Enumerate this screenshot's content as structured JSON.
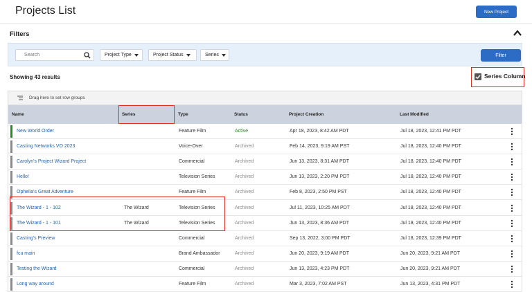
{
  "header": {
    "title": "Projects List",
    "new_project_label": "New Project"
  },
  "filters": {
    "title": "Filters",
    "search_placeholder": "Search",
    "project_type_label": "Project Type",
    "project_status_label": "Project Status",
    "series_label": "Series",
    "filter_button_label": "Filter"
  },
  "results": {
    "count_text": "Showing 43 results",
    "series_column_label": "Series Column",
    "series_column_checked": true
  },
  "grid": {
    "group_hint": "Drag here to set row groups",
    "columns": [
      "Name",
      "Series",
      "Type",
      "Status",
      "Project Creation",
      "Last Modified"
    ],
    "rows": [
      {
        "name": "New World Order",
        "series": "",
        "type": "Feature Film",
        "status": "Active",
        "created": "Apr 18, 2023, 8:42 AM PDT",
        "modified": "Jul 18, 2023, 12:41 PM PDT"
      },
      {
        "name": "Casting Networks VO 2023",
        "series": "",
        "type": "Voice-Over",
        "status": "Archived",
        "created": "Feb 14, 2023, 9:19 AM PST",
        "modified": "Jul 18, 2023, 12:40 PM PDT"
      },
      {
        "name": "Carolyn's Project Wizard Project",
        "series": "",
        "type": "Commercial",
        "status": "Archived",
        "created": "Jun 13, 2023, 8:31 AM PDT",
        "modified": "Jul 18, 2023, 12:40 PM PDT"
      },
      {
        "name": "Hello!",
        "series": "",
        "type": "Television Series",
        "status": "Archived",
        "created": "Jun 13, 2023, 2:20 PM PDT",
        "modified": "Jul 18, 2023, 12:40 PM PDT"
      },
      {
        "name": "Ophelia's Great Adventure",
        "series": "",
        "type": "Feature Film",
        "status": "Archived",
        "created": "Feb 8, 2023, 2:50 PM PST",
        "modified": "Jul 18, 2023, 12:40 PM PDT"
      },
      {
        "name": "The Wizard - 1 - 102",
        "series": "The Wizard",
        "type": "Television Series",
        "status": "Archived",
        "created": "Jul 11, 2023, 10:25 AM PDT",
        "modified": "Jul 18, 2023, 12:40 PM PDT"
      },
      {
        "name": "The Wizard - 1 - 101",
        "series": "The Wizard",
        "type": "Television Series",
        "status": "Archived",
        "created": "Jun 13, 2023, 8:36 AM PDT",
        "modified": "Jul 18, 2023, 12:40 PM PDT"
      },
      {
        "name": "Casting's Preview",
        "series": "",
        "type": "Commercial",
        "status": "Archived",
        "created": "Sep 13, 2022, 3:00 PM PDT",
        "modified": "Jul 18, 2023, 12:39 PM PDT"
      },
      {
        "name": "fcu main",
        "series": "",
        "type": "Brand Ambassador",
        "status": "Archived",
        "created": "Jun 20, 2023, 9:19 AM PDT",
        "modified": "Jun 20, 2023, 9:21 AM PDT"
      },
      {
        "name": "Testing the Wizard",
        "series": "",
        "type": "Commercial",
        "status": "Archived",
        "created": "Jun 13, 2023, 4:23 PM PDT",
        "modified": "Jun 20, 2023, 9:21 AM PDT"
      },
      {
        "name": "Long way around",
        "series": "",
        "type": "Feature Film",
        "status": "Archived",
        "created": "Mar 3, 2023, 7:02 AM PST",
        "modified": "Jun 13, 2023, 4:31 PM PDT"
      }
    ]
  },
  "colors": {
    "primary": "#2d6cc4",
    "highlight": "#e0301e",
    "active": "#2a8a2a",
    "archived_bar": "#8a8a8a",
    "link": "#2563b0"
  }
}
